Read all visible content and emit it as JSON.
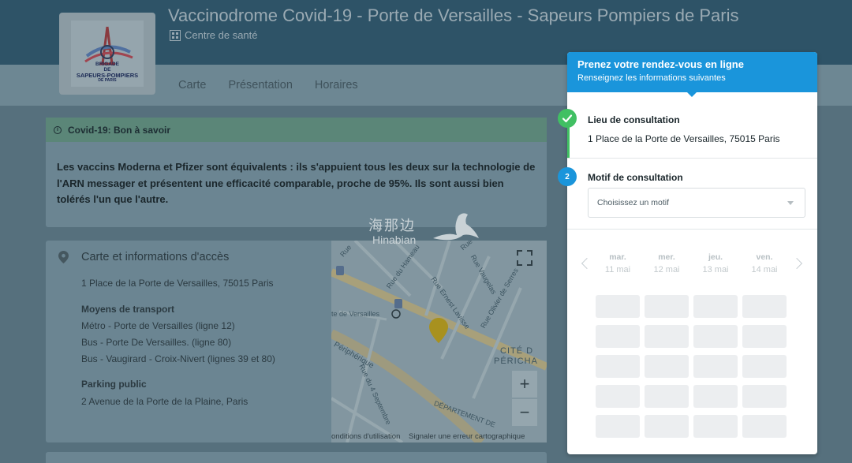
{
  "header": {
    "title": "Vaccinodrome Covid-19 - Porte de Versailles - Sapeurs Pompiers de Paris",
    "subtitle": "Centre de santé",
    "logo_caption_line1": "BRIGADE",
    "logo_caption_line2": "DE",
    "logo_caption_line3": "SAPEURS-POMPIERS",
    "logo_caption_line4": "DE PARIS"
  },
  "nav": {
    "items": [
      "Carte",
      "Présentation",
      "Horaires"
    ]
  },
  "info": {
    "heading": "Covid-19: Bon à savoir",
    "body": "Les vaccins Moderna et Pfizer sont équivalents : ils s'appuient tous les deux sur la technologie de l'ARN messager et présentent une efficacité comparable, proche de 95%. Ils sont aussi bien tolérés l'un que l'autre."
  },
  "access": {
    "title": "Carte et informations d'accès",
    "address": "1 Place de la Porte de Versailles, 75015 Paris",
    "transport_heading": "Moyens de transport",
    "transport_lines": [
      "Métro - Porte de Versailles (ligne 12)",
      "Bus - Porte De Versailles. (ligne 80)",
      "Bus - Vaugirard - Croix-Nivert (lignes 39 et 80)"
    ],
    "parking_heading": "Parking public",
    "parking_address": "2 Avenue de la Porte de la Plaine, Paris"
  },
  "map": {
    "labels": {
      "versailles": "te de Versailles",
      "hameau": "Rue du Hameau",
      "vaugelas": "Rue Vaugelas",
      "ernest": "Rue Ernest Lavisse",
      "olivier": "Rue Olivier de Serres",
      "peripherique": "Périphérique",
      "septembre": "Rue du 4 Septembre",
      "departement": "DÉPARTEMENT DE",
      "cite1": "CITÉ D",
      "cite2": "PÉRICHA",
      "rue1": "Rue",
      "rue2": "Rue"
    },
    "zoom_in": "+",
    "zoom_out": "−",
    "terms": "onditions d'utilisation",
    "report": "Signaler une erreur cartographique"
  },
  "watermark": {
    "cn": "海那边",
    "en": "Hinabian"
  },
  "booking": {
    "title": "Prenez votre rendez-vous en ligne",
    "subtitle": "Renseignez les informations suivantes",
    "step1_label": "Lieu de consultation",
    "step1_value": "1 Place de la Porte de Versailles, 75015 Paris",
    "step2_number": "2",
    "step2_label": "Motif de consultation",
    "motif_placeholder": "Choisissez un motif",
    "days": [
      {
        "name": "mar.",
        "date": "11 mai"
      },
      {
        "name": "mer.",
        "date": "12 mai"
      },
      {
        "name": "jeu.",
        "date": "13 mai"
      },
      {
        "name": "ven.",
        "date": "14 mai"
      }
    ]
  },
  "colors": {
    "accent": "#1a95db",
    "success": "#41c063",
    "header_bg": "#2e5367"
  }
}
